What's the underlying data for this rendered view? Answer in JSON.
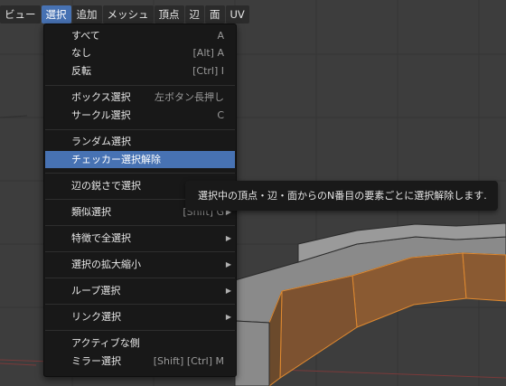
{
  "menubar": {
    "items": [
      {
        "label": "ビュー"
      },
      {
        "label": "選択"
      },
      {
        "label": "追加"
      },
      {
        "label": "メッシュ"
      },
      {
        "label": "頂点"
      },
      {
        "label": "辺"
      },
      {
        "label": "面"
      },
      {
        "label": "UV"
      }
    ]
  },
  "select_menu": {
    "items": [
      {
        "label": "すべて",
        "shortcut": "A"
      },
      {
        "label": "なし",
        "shortcut": "[Alt] A"
      },
      {
        "label": "反転",
        "shortcut": "[Ctrl] I"
      },
      {
        "label": "ボックス選択",
        "shortcut": "左ボタン長押し"
      },
      {
        "label": "サークル選択",
        "shortcut": "C"
      },
      {
        "label": "ランダム選択",
        "shortcut": ""
      },
      {
        "label": "チェッカー選択解除",
        "shortcut": ""
      },
      {
        "label": "辺の鋭さで選択",
        "shortcut": ""
      },
      {
        "label": "類似選択",
        "shortcut": "[Shift] G"
      },
      {
        "label": "特徴で全選択",
        "shortcut": ""
      },
      {
        "label": "選択の拡大縮小",
        "shortcut": ""
      },
      {
        "label": "ループ選択",
        "shortcut": ""
      },
      {
        "label": "リンク選択",
        "shortcut": ""
      },
      {
        "label": "アクティブな側",
        "shortcut": ""
      },
      {
        "label": "ミラー選択",
        "shortcut": "[Shift] [Ctrl] M"
      }
    ]
  },
  "tooltip": {
    "text": "選択中の頂点・辺・面からのN番目の要素ごとに選択解除します."
  },
  "colors": {
    "accent": "#4772b3",
    "menu_bg": "#181818",
    "viewport_bg": "#3d3d3d",
    "selected_face": "#f0a040"
  }
}
